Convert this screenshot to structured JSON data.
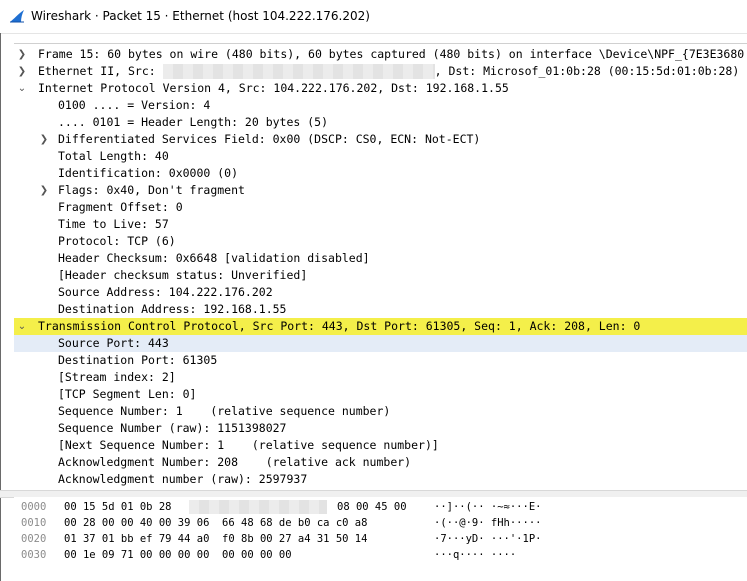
{
  "window": {
    "title": "Wireshark · Packet 15 · Ethernet (host 104.222.176.202)"
  },
  "tree": [
    {
      "text": "Frame 15: 60 bytes on wire (480 bits), 60 bytes captured (480 bits) on interface \\Device\\NPF_{7E3E3680",
      "expander": "collapsed"
    },
    {
      "pre": "Ethernet II, Src: ",
      "post": ", Dst: Microsof_01:0b:28 (00:15:5d:01:0b:28)",
      "expander": "collapsed"
    },
    {
      "text": "Internet Protocol Version 4, Src: 104.222.176.202, Dst: 192.168.1.55",
      "expander": "expanded"
    },
    {
      "text": "0100 .... = Version: 4"
    },
    {
      "text": ".... 0101 = Header Length: 20 bytes (5)"
    },
    {
      "text": "Differentiated Services Field: 0x00 (DSCP: CS0, ECN: Not-ECT)",
      "expander": "collapsed"
    },
    {
      "text": "Total Length: 40"
    },
    {
      "text": "Identification: 0x0000 (0)"
    },
    {
      "text": "Flags: 0x40, Don't fragment",
      "expander": "collapsed"
    },
    {
      "text": "Fragment Offset: 0"
    },
    {
      "text": "Time to Live: 57"
    },
    {
      "text": "Protocol: TCP (6)"
    },
    {
      "text": "Header Checksum: 0x6648 [validation disabled]"
    },
    {
      "text": "[Header checksum status: Unverified]"
    },
    {
      "text": "Source Address: 104.222.176.202"
    },
    {
      "text": "Destination Address: 192.168.1.55"
    },
    {
      "text": "Transmission Control Protocol, Src Port: 443, Dst Port: 61305, Seq: 1, Ack: 208, Len: 0",
      "expander": "expanded"
    },
    {
      "text": "Source Port: 443"
    },
    {
      "text": "Destination Port: 61305"
    },
    {
      "text": "[Stream index: 2]"
    },
    {
      "text": "[TCP Segment Len: 0]"
    },
    {
      "text": "Sequence Number: 1    (relative sequence number)"
    },
    {
      "text": "Sequence Number (raw): 1151398027"
    },
    {
      "text": "[Next Sequence Number: 1    (relative sequence number)]"
    },
    {
      "text": "Acknowledgment Number: 208    (relative ack number)"
    },
    {
      "text": "Acknowledgment number (raw): 2597937"
    }
  ],
  "bytes": [
    {
      "offset": "0000",
      "hex_a": "00 15 5d 01 0b 28",
      "hex_b": "08 00 45 00",
      "ascii": "··]··(··  ·~≈···E·"
    },
    {
      "offset": "0010",
      "hex": "00 28 00 00 40 00 39 06  66 48 68 de b0 ca c0 a8",
      "ascii": "·(··@·9· fHh·····"
    },
    {
      "offset": "0020",
      "hex": "01 37 01 bb ef 79 44 a0  f0 8b 00 27 a4 31 50 14",
      "ascii": "·7···yD· ···'·1P·"
    },
    {
      "offset": "0030",
      "hex": "00 1e 09 71 00 00 00 00  00 00 00 00",
      "ascii": "···q···· ····"
    }
  ],
  "colors": {
    "highlight_row": "#f4ef4a",
    "selected_row": "#e4ecf7",
    "offset_text": "#8c8c8c",
    "wireshark_fin": "#1f6fd1"
  },
  "icons": {
    "app": "wireshark-fin-icon",
    "collapsed": "chevron-right-icon",
    "expanded": "chevron-down-icon"
  }
}
